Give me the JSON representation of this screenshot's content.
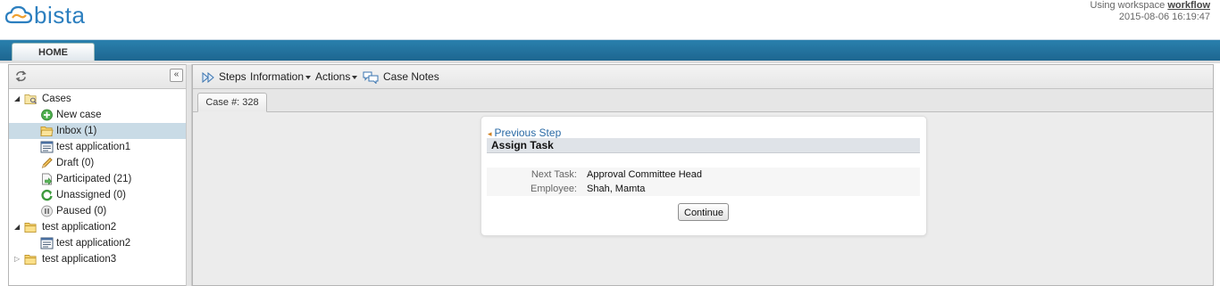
{
  "app": {
    "logo_text": "bista"
  },
  "workspace": {
    "prefix": "Using workspace",
    "name": "workflow",
    "datetime": "2015-08-06 16:19:47"
  },
  "nav": {
    "tabs": [
      {
        "label": "HOME"
      }
    ]
  },
  "tree": {
    "items": [
      {
        "label": "Cases",
        "icon": "cases-folder-icon",
        "level": 0,
        "toggle": "expanded"
      },
      {
        "label": "New case",
        "icon": "new-case-icon",
        "level": 1
      },
      {
        "label": "Inbox (1)",
        "icon": "inbox-folder-icon",
        "level": 1,
        "selected": true
      },
      {
        "label": "test application1",
        "icon": "form-icon",
        "level": 1
      },
      {
        "label": "Draft (0)",
        "icon": "pencil-icon",
        "level": 1
      },
      {
        "label": "Participated (21)",
        "icon": "participated-icon",
        "level": 1
      },
      {
        "label": "Unassigned (0)",
        "icon": "unassigned-icon",
        "level": 1
      },
      {
        "label": "Paused (0)",
        "icon": "pause-icon",
        "level": 1
      },
      {
        "label": "test application2",
        "icon": "folder-icon",
        "level": 0,
        "toggle": "expanded"
      },
      {
        "label": "test application2",
        "icon": "form-icon",
        "level": 1
      },
      {
        "label": "test application3",
        "icon": "folder-icon",
        "level": 0,
        "toggle": "collapsed"
      }
    ]
  },
  "toolbar": {
    "steps": "Steps",
    "information": "Information",
    "actions": "Actions",
    "case_notes": "Case Notes"
  },
  "case_tab": {
    "label": "Case #: 328"
  },
  "step": {
    "previous": "Previous Step",
    "title": "Assign Task",
    "next_task_label": "Next Task:",
    "next_task_value": "Approval Committee Head",
    "employee_label": "Employee:",
    "employee_value": "Shah, Mamta",
    "continue": "Continue"
  },
  "colors": {
    "brand": "#2c7fbf",
    "nav_bar": "#1d6690",
    "link": "#2a6aa5",
    "selected_row": "#c9dbe6"
  }
}
